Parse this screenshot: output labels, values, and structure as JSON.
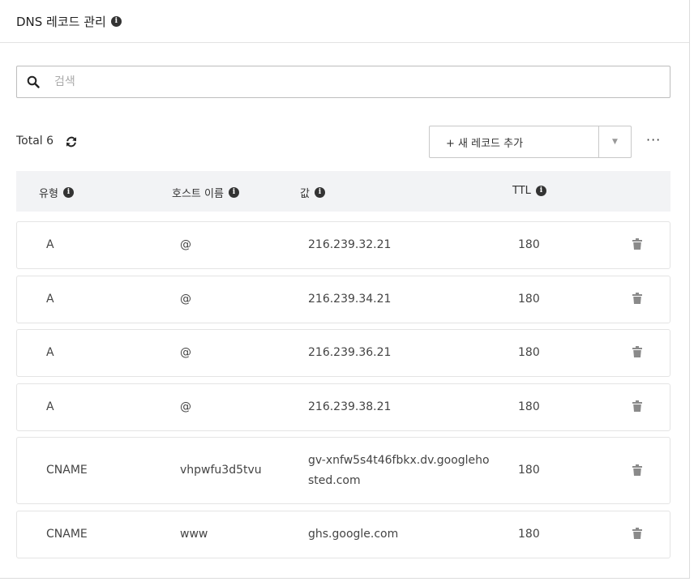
{
  "header": {
    "title": "DNS 레코드 관리"
  },
  "search": {
    "placeholder": "검색"
  },
  "toolbar": {
    "total": "Total 6",
    "add_label": "+ 새 레코드 추가",
    "dropdown_glyph": "▼",
    "more_glyph": "···"
  },
  "table": {
    "columns": [
      "유형",
      "호스트 이름",
      "값",
      "TTL"
    ],
    "rows": [
      {
        "type": "A",
        "host": "@",
        "value": "216.239.32.21",
        "ttl": "180"
      },
      {
        "type": "A",
        "host": "@",
        "value": "216.239.34.21",
        "ttl": "180"
      },
      {
        "type": "A",
        "host": "@",
        "value": "216.239.36.21",
        "ttl": "180"
      },
      {
        "type": "A",
        "host": "@",
        "value": "216.239.38.21",
        "ttl": "180"
      },
      {
        "type": "CNAME",
        "host": "vhpwfu3d5tvu",
        "value": "gv-xnfw5s4t46fbkx.dv.googlehosted.com",
        "ttl": "180"
      },
      {
        "type": "CNAME",
        "host": "www",
        "value": "ghs.google.com",
        "ttl": "180"
      }
    ]
  },
  "icons": {
    "info": "info-icon",
    "search": "search-icon",
    "refresh": "refresh-icon",
    "delete": "trash-icon"
  },
  "colors": {
    "text": "#333333",
    "header_bg": "#f2f3f5",
    "border": "#e4e4e4",
    "icon_gray": "#8a8a8a"
  }
}
